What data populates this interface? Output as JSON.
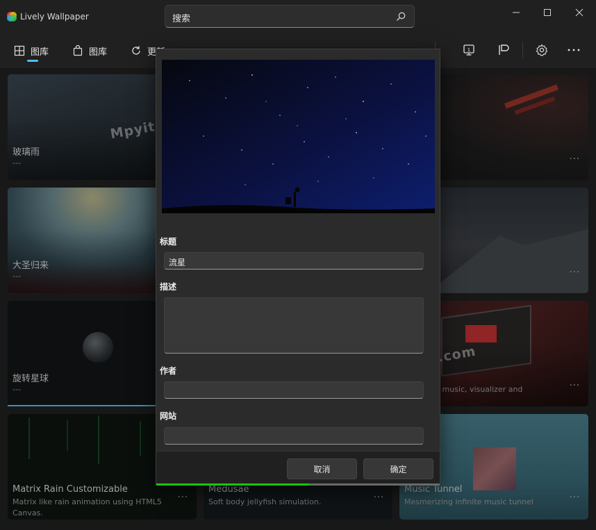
{
  "app": {
    "title": "Lively Wallpaper"
  },
  "search": {
    "text": "搜索"
  },
  "nav": [
    {
      "label": "图库",
      "icon": "grid-icon"
    },
    {
      "label": "图库",
      "icon": "bag-icon"
    },
    {
      "label": "更新",
      "icon": "refresh-icon"
    }
  ],
  "toolbar": {
    "icons": [
      "screen-icon",
      "flag-icon",
      "gear-icon",
      "more-icon"
    ]
  },
  "cards": [
    {
      "title": "玻璃雨",
      "desc": "---",
      "more": "···"
    },
    {
      "title": "",
      "desc": "",
      "more": "···"
    },
    {
      "title": "大圣归来",
      "desc": "---",
      "more": ""
    },
    {
      "title": "",
      "desc": "",
      "more": "···"
    },
    {
      "title": "旋转星球",
      "desc": "---",
      "more": ""
    },
    {
      "title": "oom",
      "desc": "oom with music, visualizer and",
      "more": "···"
    },
    {
      "title": "Matrix Rain Customizable",
      "desc": "Matrix like rain animation using HTML5 Canvas.",
      "more": "···"
    },
    {
      "title": "Medusae",
      "desc": "Soft body jellyfish simulation.",
      "more": "···"
    },
    {
      "title": "Music Tunnel",
      "desc": "Mesmerizing infinite music tunnel",
      "more": "···"
    }
  ],
  "watermark": "Mpyit.com",
  "dialog": {
    "title_label": "标题",
    "title_value": "流星",
    "desc_label": "描述",
    "desc_value": "",
    "author_label": "作者",
    "author_value": "",
    "website_label": "网站",
    "website_value": "",
    "cancel_label": "取消",
    "ok_label": "确定",
    "progress": 0.54
  },
  "colors": {
    "accent": "#4cc2ff",
    "progress": "#16c60c"
  }
}
